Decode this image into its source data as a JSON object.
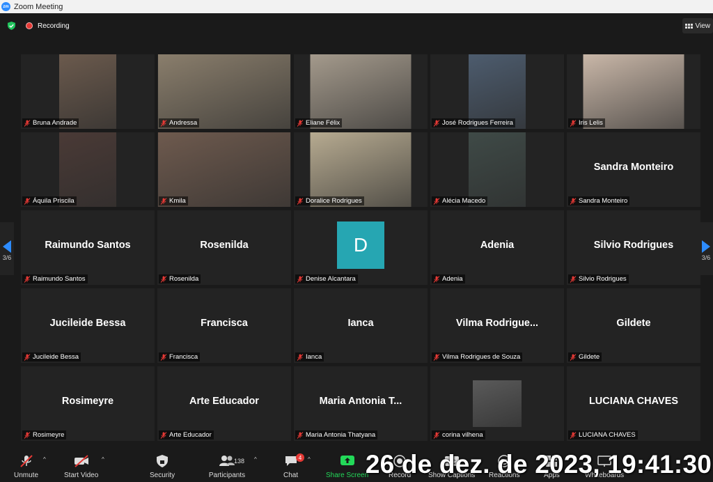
{
  "window": {
    "title": "Zoom Meeting",
    "logo_text": "zm"
  },
  "status": {
    "recording_label": "Recording",
    "view_label": "View"
  },
  "pager": {
    "left_label": "3/6",
    "right_label": "3/6"
  },
  "tiles": [
    {
      "name": "Bruna Andrade",
      "big": "",
      "video": true,
      "video_color": "#6b5a4d"
    },
    {
      "name": "Andressa",
      "big": "",
      "video": true,
      "video_color": "#8a7e6c"
    },
    {
      "name": "Eliane Félix",
      "big": "",
      "video": true,
      "video_color": "#a49a8c"
    },
    {
      "name": "José Rodrigues Ferreira",
      "big": "",
      "video": true,
      "video_color": "#4d5c6e"
    },
    {
      "name": "Iris Lelis",
      "big": "",
      "video": true,
      "video_color": "#c9b7a8"
    },
    {
      "name": "Áquila Priscila",
      "big": "",
      "video": true,
      "video_color": "#4a3a36"
    },
    {
      "name": "Kmila",
      "big": "",
      "video": true,
      "video_color": "#6e5a4e"
    },
    {
      "name": "Doralice Rodrigues",
      "big": "",
      "video": true,
      "video_color": "#b7ab91"
    },
    {
      "name": "Alécia Macedo",
      "big": "",
      "video": true,
      "video_color": "#3f4a47"
    },
    {
      "name": "Sandra Monteiro",
      "big": "Sandra Monteiro",
      "video": false
    },
    {
      "name": "Raimundo Santos",
      "big": "Raimundo Santos",
      "video": false
    },
    {
      "name": "Rosenilda",
      "big": "Rosenilda",
      "video": false
    },
    {
      "name": "Denise Alcantara",
      "big": "",
      "video": false,
      "avatar": "D"
    },
    {
      "name": "Adenia",
      "big": "Adenia",
      "video": false
    },
    {
      "name": "Silvio Rodrigues",
      "big": "Silvio Rodrigues",
      "video": false
    },
    {
      "name": "Jucileide Bessa",
      "big": "Jucileide Bessa",
      "video": false
    },
    {
      "name": "Francisca",
      "big": "Francisca",
      "video": false
    },
    {
      "name": "Ianca",
      "big": "Ianca",
      "video": false
    },
    {
      "name": "Vilma Rodrigues de Souza",
      "big": "Vilma  Rodrigue...",
      "video": false
    },
    {
      "name": "Gildete",
      "big": "Gildete",
      "video": false
    },
    {
      "name": "Rosimeyre",
      "big": "Rosimeyre",
      "video": false
    },
    {
      "name": "Arte Educador",
      "big": "Arte Educador",
      "video": false
    },
    {
      "name": "Maria Antonia Thatyana",
      "big": "Maria  Antonia  T...",
      "video": false
    },
    {
      "name": "corina vilhena",
      "big": "",
      "video": true,
      "video_color": "#5a5a5a"
    },
    {
      "name": "LUCIANA CHAVES",
      "big": "LUCIANA CHAVES",
      "video": false
    }
  ],
  "toolbar": {
    "unmute": "Unmute",
    "start_video": "Start Video",
    "security": "Security",
    "participants": "Participants",
    "participants_count": "138",
    "chat": "Chat",
    "chat_badge": "4",
    "share_screen": "Share Screen",
    "record": "Record",
    "show_captions": "Show Captions",
    "reactions": "Reactions",
    "apps": "Apps",
    "whiteboards": "Whiteboards"
  },
  "overlay": {
    "timestamp": "26 de dez. de 2023, 19:41:30"
  },
  "colors": {
    "accent": "#2d8cff",
    "share_green": "#23d959",
    "record_red": "#e53935",
    "avatar_teal": "#26a6b2"
  }
}
